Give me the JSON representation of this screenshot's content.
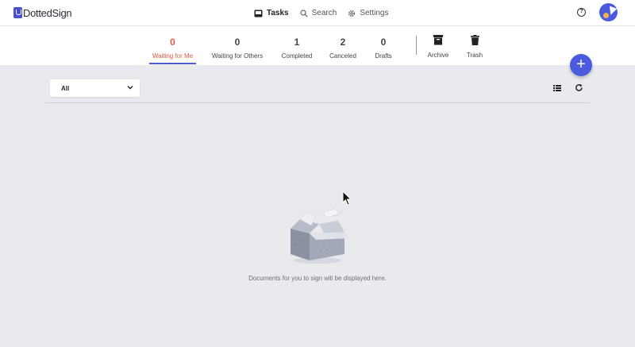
{
  "app": {
    "logo_text": "DottedSign"
  },
  "nav": {
    "tasks": "Tasks",
    "search": "Search",
    "settings": "Settings"
  },
  "status_tabs": [
    {
      "count": "0",
      "label": "Waiting for Me"
    },
    {
      "count": "0",
      "label": "Waiting for Others"
    },
    {
      "count": "1",
      "label": "Completed"
    },
    {
      "count": "2",
      "label": "Canceled"
    },
    {
      "count": "0",
      "label": "Drafts"
    }
  ],
  "folders": [
    {
      "label": "Archive",
      "icon": "archive-icon"
    },
    {
      "label": "Trash",
      "icon": "trash-icon"
    }
  ],
  "fab_label": "+",
  "filter": {
    "selected": "All"
  },
  "empty_state": {
    "message": "Documents for you to sign will be displayed here."
  },
  "colors": {
    "accent": "#4a5be0",
    "active_tab": "#e05a44",
    "background": "#e8eaee"
  }
}
